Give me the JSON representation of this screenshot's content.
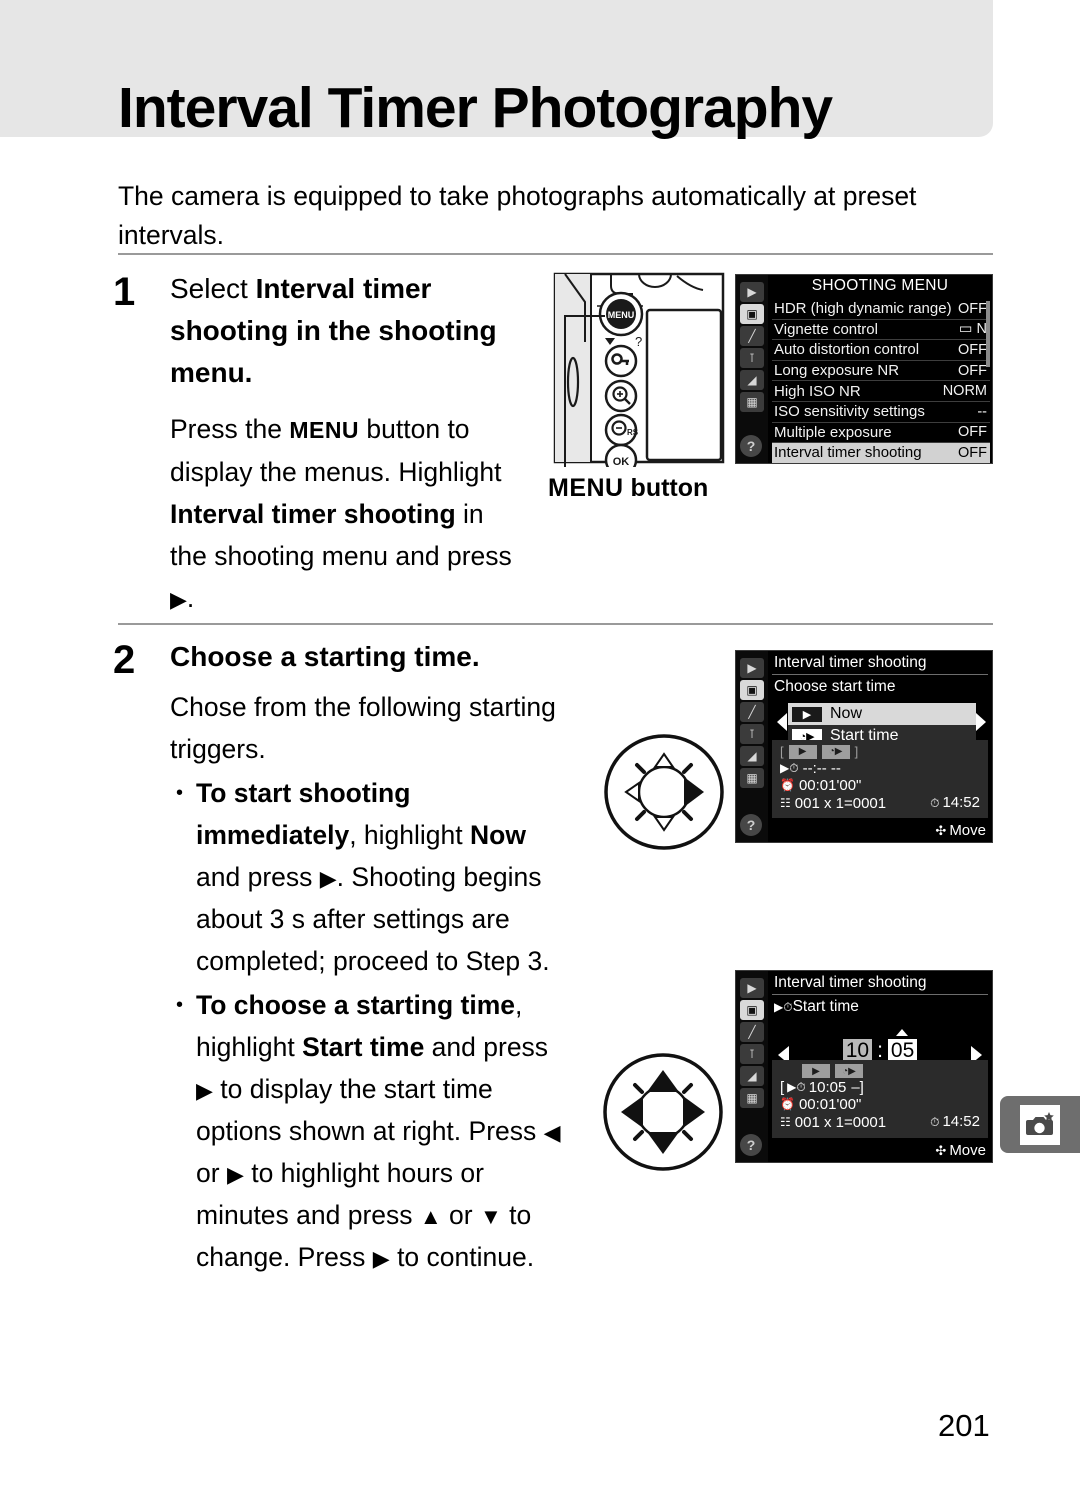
{
  "page": {
    "title": "Interval Timer Photography",
    "intro": "The camera is equipped to take photographs automatically at preset intervals.",
    "page_number": "201",
    "side_tab_icon": "camera-star-icon"
  },
  "step1": {
    "number": "1",
    "heading_a": "Select ",
    "heading_b": "Interval timer shooting",
    "heading_c": " in the shooting menu.",
    "body_1": "Press the ",
    "menu_word": "MENU",
    "body_2": " button to display the menus. Highlight ",
    "body_bold": "Interval timer shooting",
    "body_3": " in the shooting menu and press ",
    "arrow_right": "▶",
    "body_4": "."
  },
  "camera_figure": {
    "label_menu": "MENU",
    "label_button": " button",
    "buttons": [
      "MENU",
      "key-lock-icon",
      "zoom-in-icon",
      "zoom-out-icon",
      "ok-icon"
    ],
    "help_mark": "?"
  },
  "shooting_menu": {
    "title": "SHOOTING MENU",
    "sidebar_icons": [
      "playback-icon",
      "shooting-icon",
      "custom-settings-icon",
      "setup-icon",
      "retouch-icon",
      "recent-settings-icon"
    ],
    "help_icon": "?",
    "rows": [
      {
        "label": "HDR (high dynamic range)",
        "value": "OFF",
        "selected": false
      },
      {
        "label": "Vignette control",
        "value": "▭ N",
        "selected": false
      },
      {
        "label": "Auto distortion control",
        "value": "OFF",
        "selected": false
      },
      {
        "label": "Long exposure NR",
        "value": "OFF",
        "selected": false
      },
      {
        "label": "High ISO NR",
        "value": "NORM",
        "selected": false
      },
      {
        "label": "ISO sensitivity settings",
        "value": "--",
        "selected": false
      },
      {
        "label": "Multiple exposure",
        "value": "OFF",
        "selected": false
      },
      {
        "label": "Interval timer shooting",
        "value": "OFF",
        "selected": true
      }
    ]
  },
  "step2": {
    "number": "2",
    "heading": "Choose a starting time.",
    "intro": "Chose from the following starting triggers.",
    "bullet1_bold": "To start shooting immediately",
    "bullet1_a": ", highlight ",
    "bullet1_now": "Now",
    "bullet1_b": " and press ",
    "bullet1_arrow": "▶",
    "bullet1_c": ". Shooting begins about 3 s after settings are completed; proceed to Step 3.",
    "bullet2_bold": "To choose a starting time",
    "bullet2_a": ", highlight ",
    "bullet2_start": "Start time",
    "bullet2_b": " and press ",
    "bullet2_arrow1": "▶",
    "bullet2_c": " to display the start time options shown at right. Press ",
    "bullet2_arrow_left": "◀",
    "bullet2_d": " or ",
    "bullet2_arrow2": "▶",
    "bullet2_e": " to highlight hours or minutes and press ",
    "bullet2_arrow_up": "▲",
    "bullet2_f": " or ",
    "bullet2_arrow_down": "▼",
    "bullet2_g": " to change.  Press ",
    "bullet2_arrow3": "▶",
    "bullet2_h": " to continue."
  },
  "lcd_choose_start": {
    "header": "Interval timer shooting",
    "sub": "Choose start time",
    "options": [
      {
        "badge": "▶",
        "label": "Now",
        "highlighted": true
      },
      {
        "badge": "◔▶",
        "label": "Start time",
        "highlighted": false
      }
    ],
    "info_badges": [
      "▶",
      "◔▶"
    ],
    "info_bracket_open": "[",
    "info_bracket_close": "]",
    "start_time_value": "--:-- --",
    "interval_value": "00:01'00\"",
    "frames_value": "001 x 1=0001",
    "clock_value": "14:52",
    "move_hint": "Move"
  },
  "lcd_start_time": {
    "header": "Interval timer shooting",
    "sub": "Start time",
    "hours": "10",
    "separator": ":",
    "minutes": "05",
    "info_badges": [
      "▶",
      "◔▶"
    ],
    "start_time_value": "10:05",
    "start_time_suffix": "–",
    "interval_value": "00:01'00\"",
    "frames_value": "001 x 1=0001",
    "clock_value": "14:52",
    "move_hint": "Move"
  }
}
